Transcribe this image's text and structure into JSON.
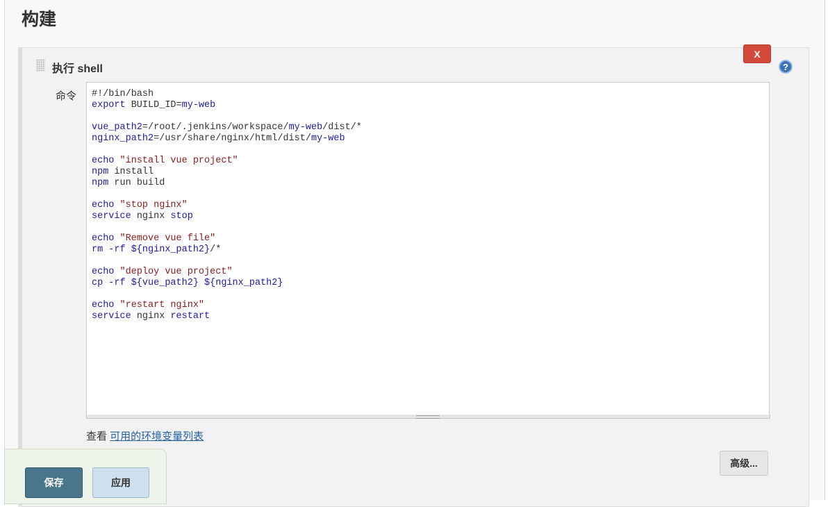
{
  "section": {
    "title": "构建"
  },
  "step": {
    "title": "执行 shell",
    "delete_label": "X",
    "help_symbol": "?"
  },
  "command": {
    "label": "命令",
    "lines": [
      [
        {
          "t": "#!/bin/bash",
          "c": "plain"
        }
      ],
      [
        {
          "t": "export",
          "c": "kw"
        },
        {
          "t": " BUILD_ID=",
          "c": "plain"
        },
        {
          "t": "my-web",
          "c": "kw"
        }
      ],
      [],
      [
        {
          "t": "vue_path2",
          "c": "kw"
        },
        {
          "t": "=/root/.jenkins/workspace/",
          "c": "plain"
        },
        {
          "t": "my-web",
          "c": "kw"
        },
        {
          "t": "/dist/*",
          "c": "plain"
        }
      ],
      [
        {
          "t": "nginx_path2",
          "c": "kw"
        },
        {
          "t": "=/usr/share/nginx/html/dist/",
          "c": "plain"
        },
        {
          "t": "my-web",
          "c": "kw"
        }
      ],
      [],
      [
        {
          "t": "echo",
          "c": "kw"
        },
        {
          "t": " ",
          "c": "plain"
        },
        {
          "t": "\"install vue project\"",
          "c": "str"
        }
      ],
      [
        {
          "t": "npm",
          "c": "kw"
        },
        {
          "t": " install",
          "c": "plain"
        }
      ],
      [
        {
          "t": "npm",
          "c": "kw"
        },
        {
          "t": " run build",
          "c": "plain"
        }
      ],
      [],
      [
        {
          "t": "echo",
          "c": "kw"
        },
        {
          "t": " ",
          "c": "plain"
        },
        {
          "t": "\"stop nginx\"",
          "c": "str"
        }
      ],
      [
        {
          "t": "service",
          "c": "kw"
        },
        {
          "t": " nginx ",
          "c": "plain"
        },
        {
          "t": "stop",
          "c": "kw"
        }
      ],
      [],
      [
        {
          "t": "echo",
          "c": "kw"
        },
        {
          "t": " ",
          "c": "plain"
        },
        {
          "t": "\"Remove vue file\"",
          "c": "str"
        }
      ],
      [
        {
          "t": "rm -rf ${nginx_path2}",
          "c": "kw"
        },
        {
          "t": "/*",
          "c": "plain"
        }
      ],
      [],
      [
        {
          "t": "echo",
          "c": "kw"
        },
        {
          "t": " ",
          "c": "plain"
        },
        {
          "t": "\"deploy vue project\"",
          "c": "str"
        }
      ],
      [
        {
          "t": "cp -rf ${vue_path2} ${nginx_path2}",
          "c": "kw"
        }
      ],
      [],
      [
        {
          "t": "echo",
          "c": "kw"
        },
        {
          "t": " ",
          "c": "plain"
        },
        {
          "t": "\"restart nginx\"",
          "c": "str"
        }
      ],
      [
        {
          "t": "service",
          "c": "kw"
        },
        {
          "t": " nginx ",
          "c": "plain"
        },
        {
          "t": "restart",
          "c": "kw"
        }
      ]
    ]
  },
  "env": {
    "prefix": "查看 ",
    "link_label": "可用的环境变量列表"
  },
  "buttons": {
    "advanced": "高级...",
    "save": "保存",
    "apply": "应用"
  },
  "colors": {
    "keyword": "#1d1aa6",
    "string": "#8b1a1a",
    "delete_button": "#d24939",
    "save_button": "#4b758b"
  }
}
